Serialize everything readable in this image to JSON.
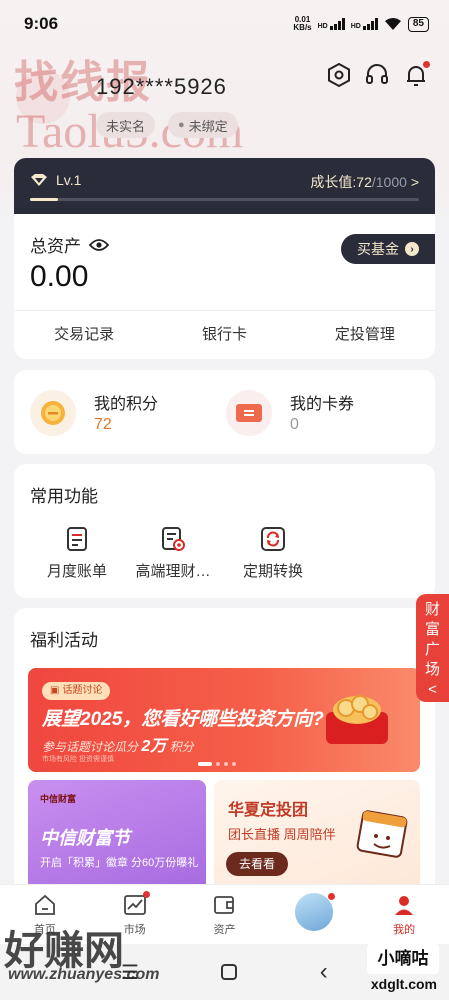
{
  "status_bar": {
    "time": "9:06",
    "speed_value": "0.01",
    "speed_unit": "KB/s",
    "hd1": "HD",
    "hd2": "HD",
    "battery": "85"
  },
  "watermarks": {
    "top_cn": "找线报",
    "top_url": "Taolu5.com",
    "bottom_cn": "好赚网",
    "bottom_url": "www.zhuanyes.com",
    "brand": "小嘀咕",
    "brand_url": "xdglt.com"
  },
  "profile": {
    "user_id": "192****5926",
    "real_name_pill": "未实名",
    "bind_pill": "未绑定"
  },
  "header_icons": [
    "settings-hex-icon",
    "headset-icon",
    "bell-icon"
  ],
  "level": {
    "label": "Lv.1",
    "growth_prefix": "成长值:",
    "growth_current": "72",
    "growth_total": "/1000",
    "arrow": ">",
    "progress_fraction": 0.072
  },
  "assets": {
    "label": "总资产",
    "value": "0.00",
    "buy_button": "买基金",
    "links": [
      "交易记录",
      "银行卡",
      "定投管理"
    ]
  },
  "points": {
    "points_label": "我的积分",
    "points_value": "72",
    "coupon_label": "我的卡券",
    "coupon_value": "0"
  },
  "functions": {
    "title": "常用功能",
    "items": [
      "月度账单",
      "高端理财…",
      "定期转换"
    ]
  },
  "welfare": {
    "title": "福利活动",
    "banner": {
      "tag": "话题讨论",
      "title": "展望2025，您看好哪些投资方向?",
      "sub_prefix": "参与话题讨论瓜分",
      "sub_highlight": "2万",
      "sub_suffix": "积分",
      "fine_print": "市场有风险 投资需谨慎"
    },
    "promo_left": {
      "logo": "中信财富",
      "title": "中信财富节",
      "sub": "开启「积累」徽章 分60万份曝礼"
    },
    "promo_right": {
      "title": "华夏定投团",
      "sub": "团长直播 周周陪伴",
      "button": "去看看"
    }
  },
  "side_tab": {
    "label": "财富广场",
    "arrow": "<"
  },
  "bottom_nav": {
    "items": [
      "首页",
      "市场",
      "资产",
      "",
      "我的"
    ],
    "active_index": 4
  },
  "colors": {
    "accent_red": "#e8413a",
    "dark_card": "#2a2c3a",
    "gold_text": "#f3e7cc",
    "points_orange": "#e0762a"
  }
}
